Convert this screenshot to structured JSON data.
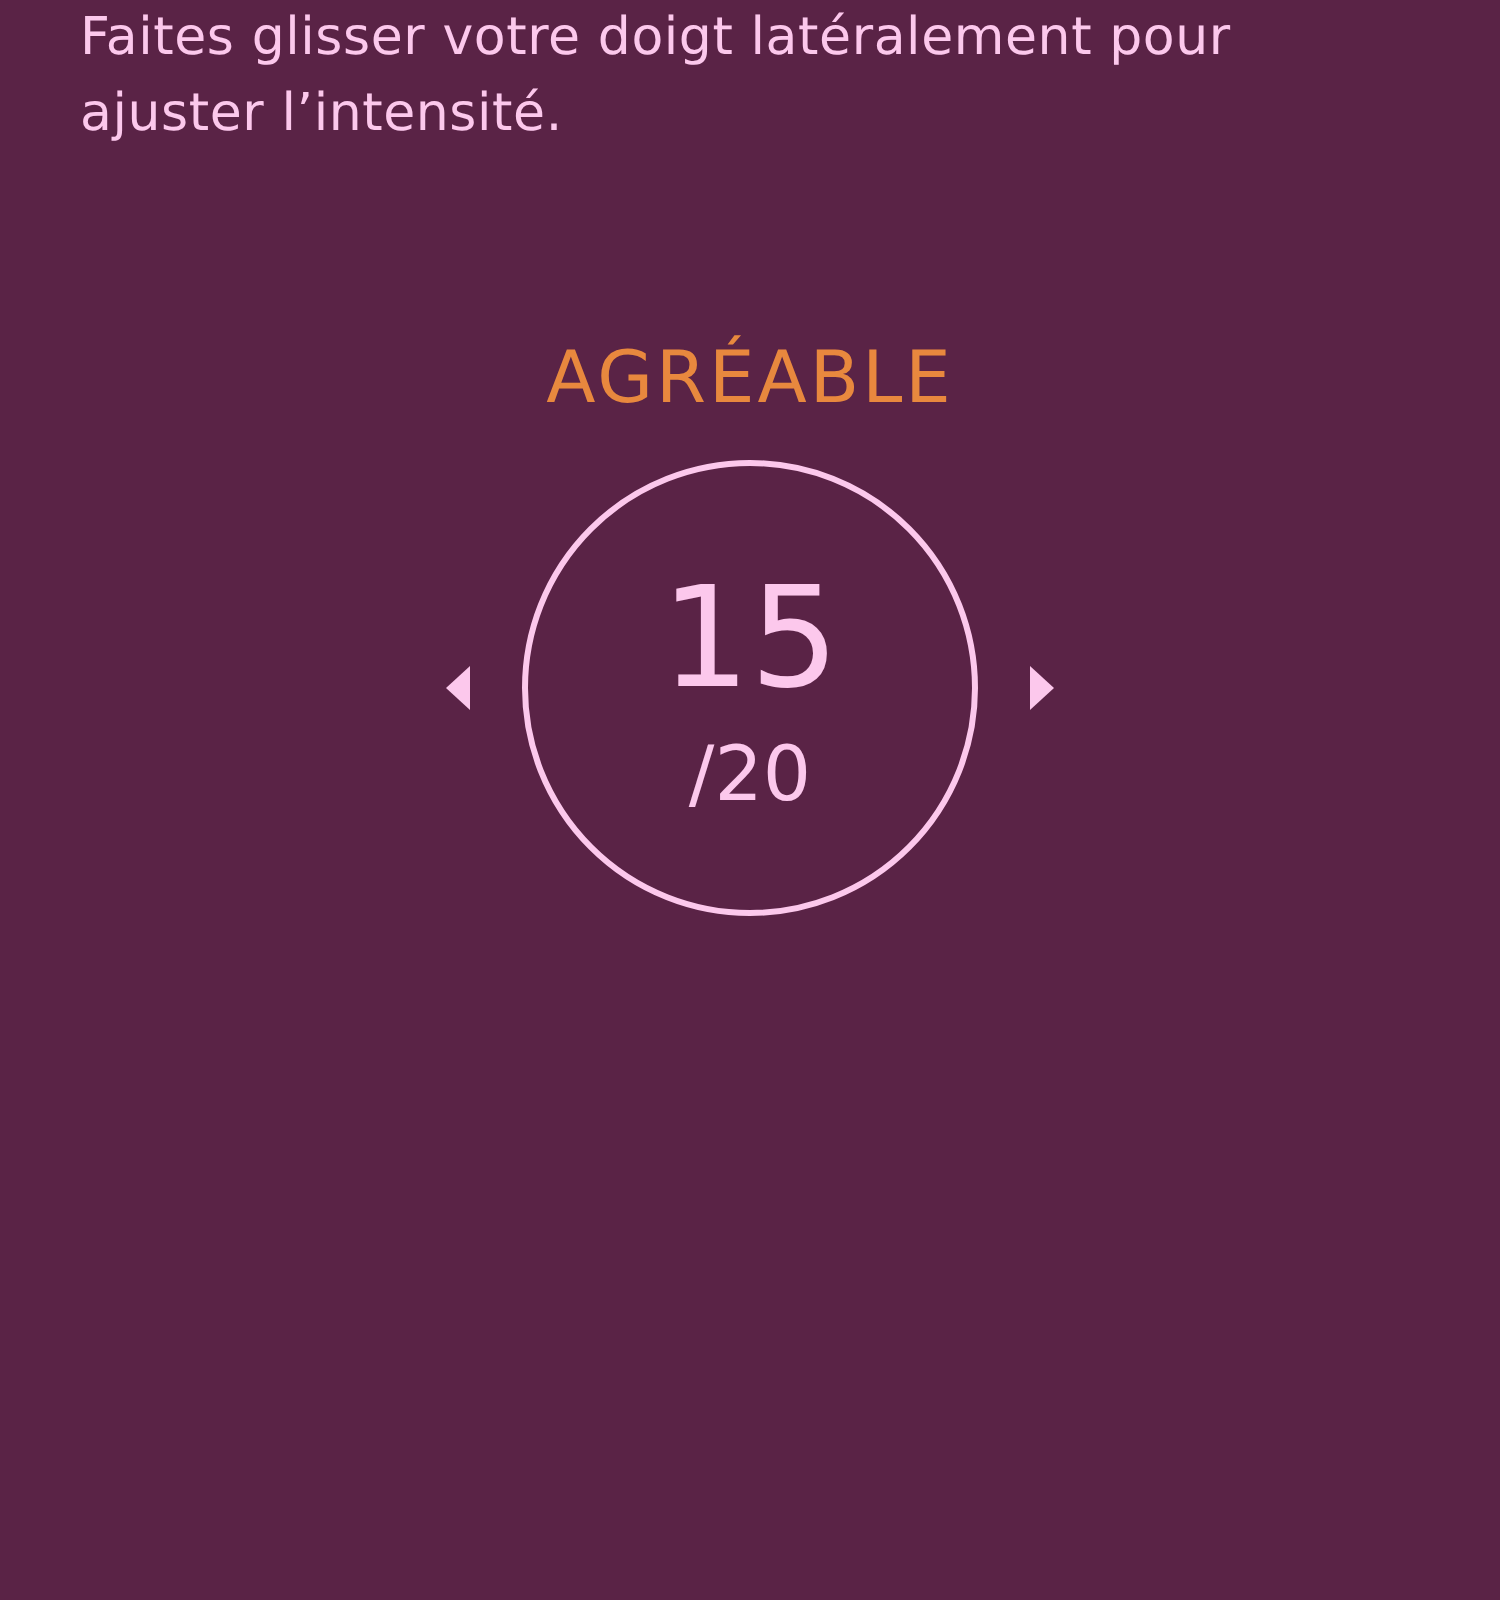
{
  "instruction": "Faites glisser votre doigt latéralement pour ajuster l’intensité.",
  "rating": {
    "label": "AGRÉABLE",
    "value": "15",
    "max": "/20"
  }
}
